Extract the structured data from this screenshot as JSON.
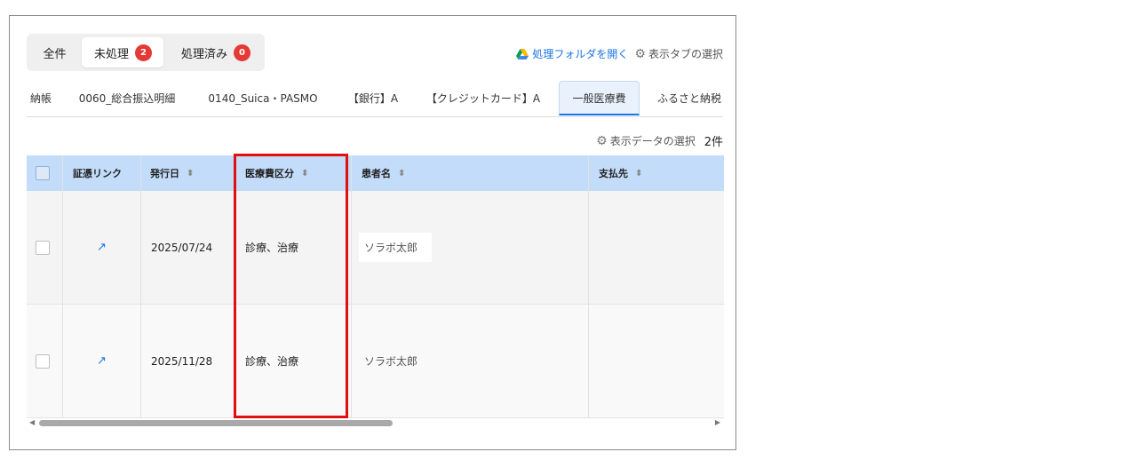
{
  "filters": {
    "all_label": "全件",
    "unprocessed_label": "未処理",
    "unprocessed_count": "2",
    "processed_label": "処理済み",
    "processed_count": "0"
  },
  "actions": {
    "open_folder_label": "処理フォルダを開く",
    "tab_select_label": "表示タブの選択"
  },
  "tabs": [
    {
      "label": "納帳"
    },
    {
      "label": "0060_総合振込明細"
    },
    {
      "label": "0140_Suica・PASMO"
    },
    {
      "label": "【銀行】A"
    },
    {
      "label": "【クレジットカード】A"
    },
    {
      "label": "一般医療費",
      "active": true
    },
    {
      "label": "ふるさと納税"
    }
  ],
  "data_select": {
    "label": "表示データの選択",
    "count": "2件"
  },
  "table": {
    "columns": [
      "証憑リンク",
      "発行日",
      "医療費区分",
      "患者名",
      "支払先"
    ],
    "rows": [
      {
        "date": "2025/07/24",
        "category": "診療、治療",
        "patient": "ソラボ太郎",
        "payee": ""
      },
      {
        "date": "2025/11/28",
        "category": "診療、治療",
        "patient": "ソラボ太郎",
        "payee": ""
      }
    ]
  },
  "colors": {
    "accent": "#1a73e8",
    "header_bg": "#c2dcf9",
    "badge": "#e53935",
    "highlight": "#e01010"
  },
  "icons": {
    "drive": "google-drive-icon",
    "gear": "gear-icon",
    "sort": "sort-icon",
    "external_link": "external-link-icon"
  }
}
